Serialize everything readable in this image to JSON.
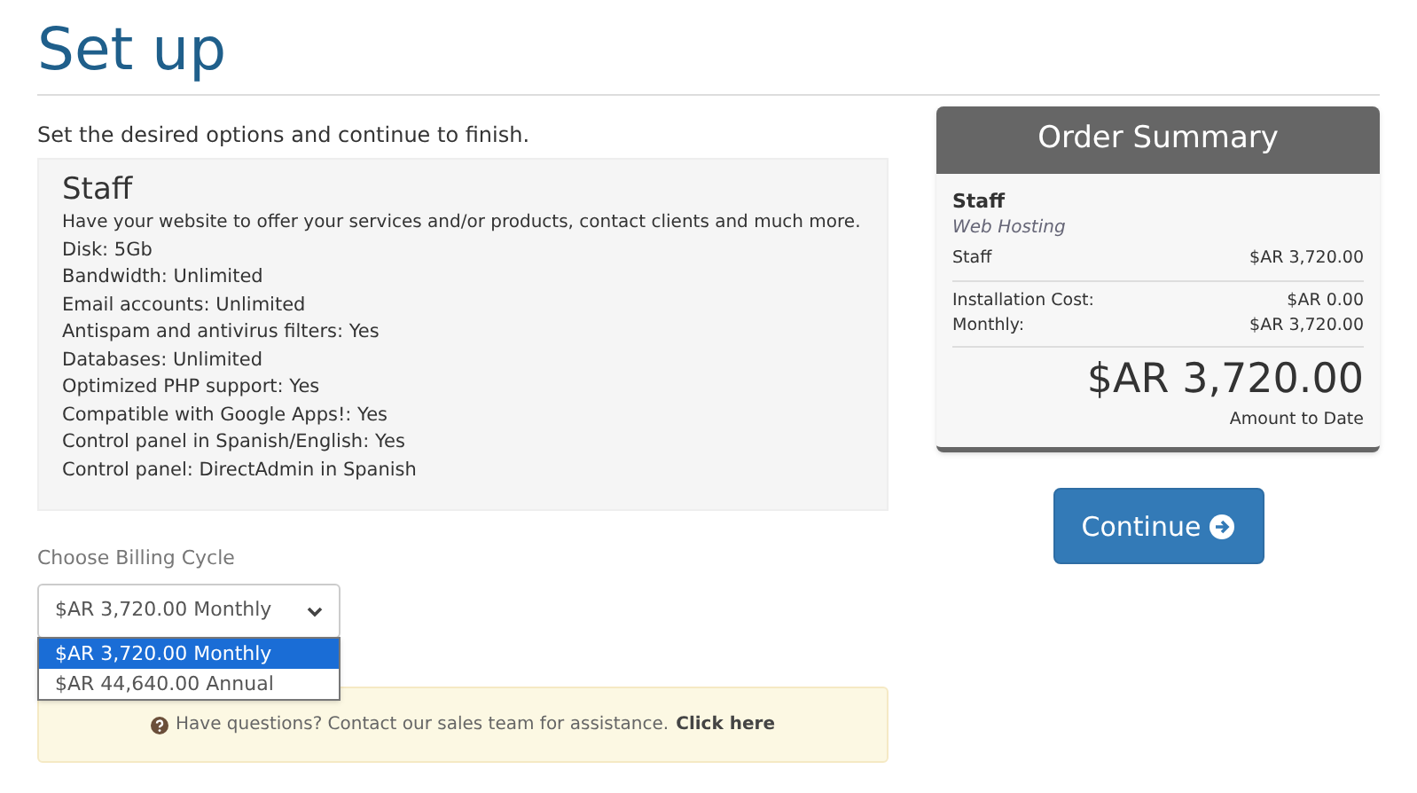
{
  "title": "Set up",
  "intro": "Set the desired options and continue to finish.",
  "product": {
    "name": "Staff",
    "description": "Have your website to offer your services and/or products, contact clients and much more.",
    "features": [
      "Disk: 5Gb",
      "Bandwidth: Unlimited",
      "Email accounts: Unlimited",
      "Antispam and antivirus filters: Yes",
      "Databases: Unlimited",
      "Optimized PHP support: Yes",
      "Compatible with Google Apps!: Yes",
      "Control panel in Spanish/English: Yes",
      "Control panel: DirectAdmin in Spanish"
    ]
  },
  "billing": {
    "label": "Choose Billing Cycle",
    "value": "$AR 3,720.00 Monthly",
    "expanded": true,
    "options": [
      {
        "label": "$AR 3,720.00 Monthly",
        "selected": true
      },
      {
        "label": "$AR 44,640.00 Annual",
        "selected": false
      }
    ]
  },
  "help": {
    "text": "Have questions? Contact our sales team for assistance.",
    "link": "Click here"
  },
  "summary": {
    "title": "Order Summary",
    "product": "Staff",
    "group": "Web Hosting",
    "item": {
      "label": "Staff",
      "amount": "$AR 3,720.00"
    },
    "lines": [
      {
        "label": "Installation Cost:",
        "amount": "$AR 0.00"
      },
      {
        "label": "Monthly:",
        "amount": "$AR 3,720.00"
      }
    ],
    "total": "$AR 3,720.00",
    "total_label": "Amount to Date"
  },
  "continue_button": "Continue"
}
